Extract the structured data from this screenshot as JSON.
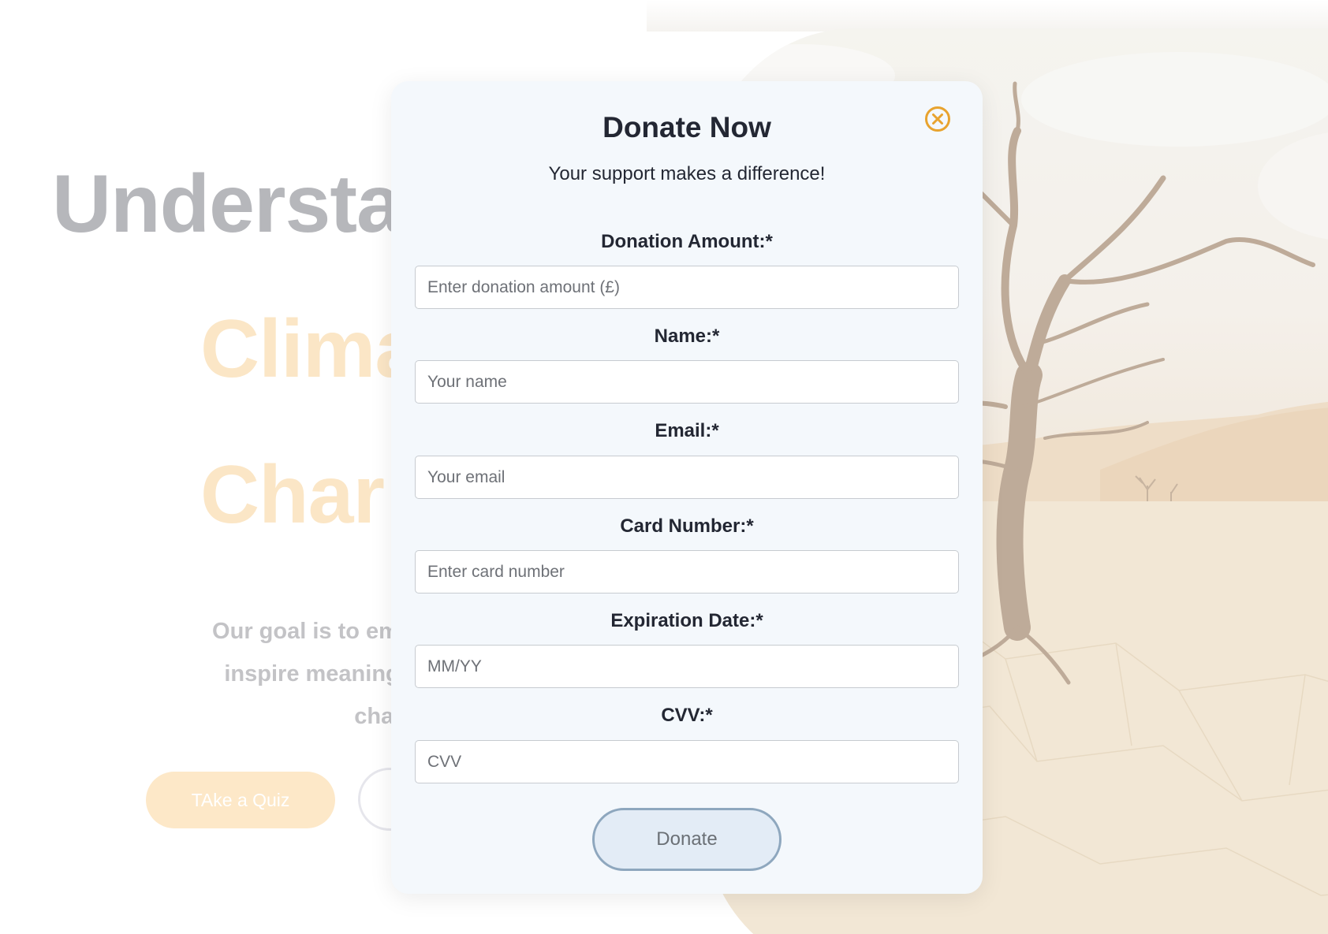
{
  "hero": {
    "title_line1": "Understa",
    "title_line2": "Clima",
    "title_line3": "Char",
    "text_line1": "Our goal is to empower you",
    "text_line2": "inspire meaningful action",
    "text_line3": "change",
    "quiz_button": "TAke a Quiz"
  },
  "modal": {
    "title": "Donate Now",
    "subtitle": "Your support makes a difference!",
    "close_icon": "close-circle-icon",
    "accent_color": "#e8a32e",
    "fields": [
      {
        "label": "Donation Amount:*",
        "placeholder": "Enter donation amount (£)",
        "value": ""
      },
      {
        "label": "Name:*",
        "placeholder": "Your name",
        "value": ""
      },
      {
        "label": "Email:*",
        "placeholder": "Your email",
        "value": ""
      },
      {
        "label": "Card Number:*",
        "placeholder": "Enter card number",
        "value": ""
      },
      {
        "label": "Expiration Date:*",
        "placeholder": "MM/YY",
        "value": ""
      },
      {
        "label": "CVV:*",
        "placeholder": "CVV",
        "value": ""
      }
    ],
    "submit_label": "Donate"
  }
}
